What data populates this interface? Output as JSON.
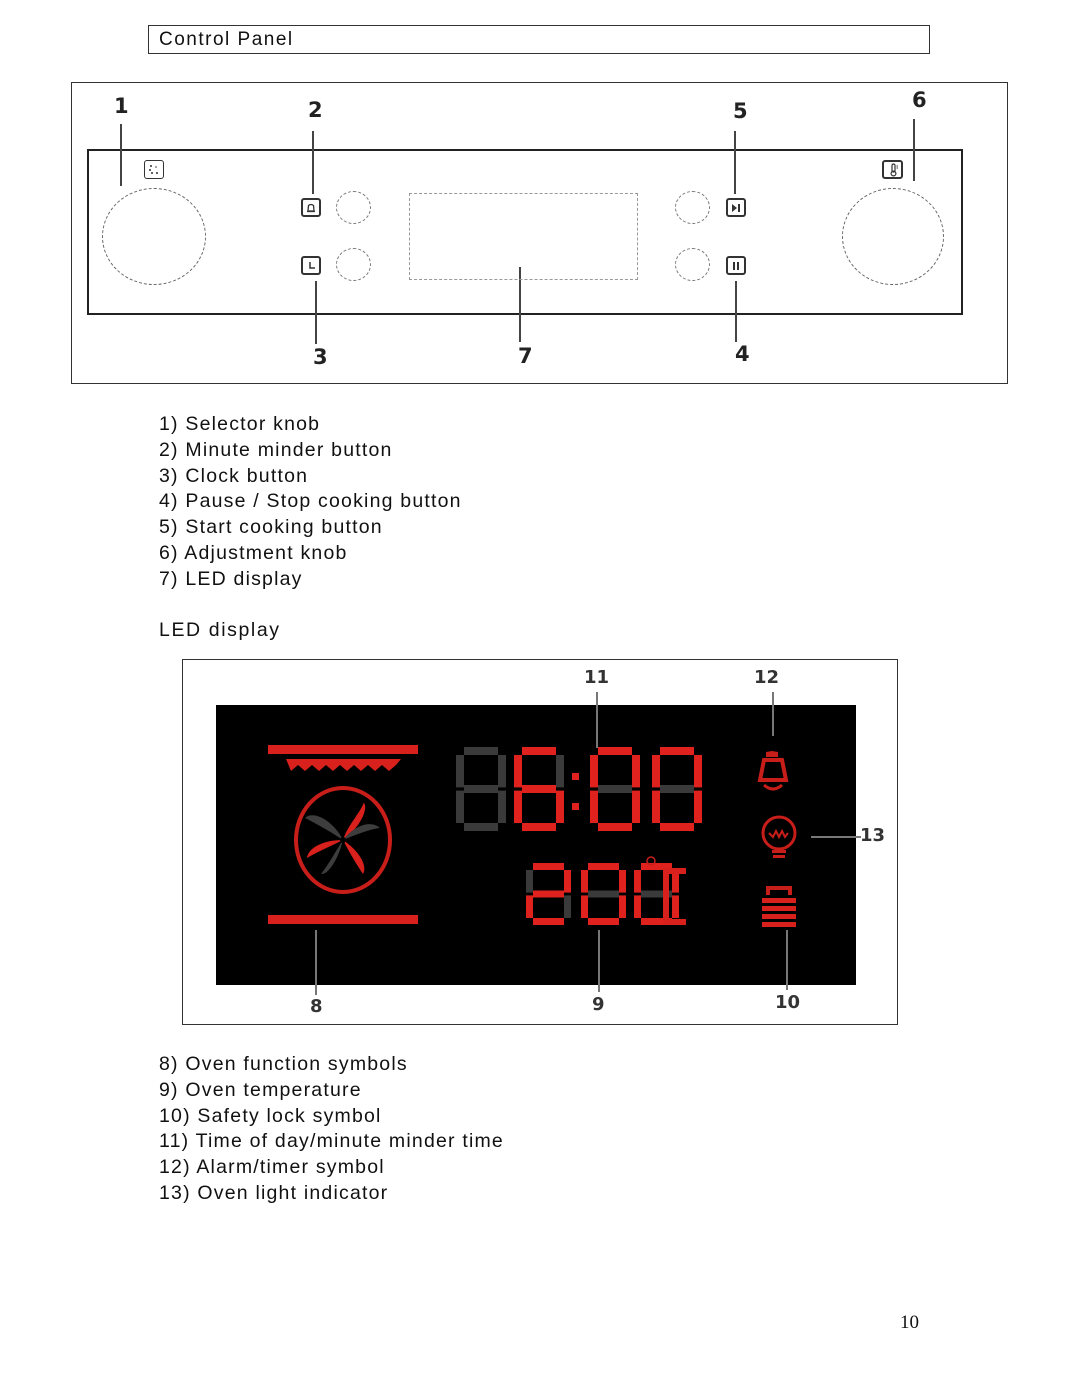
{
  "section_title": "Control Panel",
  "control_panel": {
    "callouts": [
      "1",
      "2",
      "3",
      "4",
      "5",
      "6",
      "7"
    ],
    "icons": {
      "selector": "oven-function-icon",
      "minute_minder": "bell-icon",
      "clock": "clock-icon",
      "start": "play-pause-icon",
      "pause": "pause-icon",
      "adjust": "thermometer-icon"
    }
  },
  "control_panel_legend": [
    {
      "num": "1)",
      "label": "Selector knob"
    },
    {
      "num": "2)",
      "label": "Minute minder button"
    },
    {
      "num": "3)",
      "label": "Clock button"
    },
    {
      "num": "4)",
      "label": "Pause / Stop cooking button"
    },
    {
      "num": "5)",
      "label": "Start cooking button"
    },
    {
      "num": "6)",
      "label": "Adjustment knob"
    },
    {
      "num": "7)",
      "label": "LED display"
    }
  ],
  "led_section_title": "LED display",
  "led_display": {
    "time": "06:00",
    "time_digits": [
      "0",
      "6",
      "0",
      "0"
    ],
    "time_dim_digits": [
      0
    ],
    "temperature": "200",
    "temperature_unit": "°C",
    "callouts": [
      "8",
      "9",
      "10",
      "11",
      "12",
      "13"
    ],
    "colors": {
      "active": "#e0221e",
      "inactive": "#3a3a3a",
      "background": "#000000"
    }
  },
  "led_legend": [
    {
      "num": "8)",
      "label": "Oven function symbols"
    },
    {
      "num": "9)",
      "label": "Oven temperature"
    },
    {
      "num": "10)",
      "label": "Safety lock symbol"
    },
    {
      "num": "11)",
      "label": "Time of day/minute minder time"
    },
    {
      "num": "12)",
      "label": "Alarm/timer symbol"
    },
    {
      "num": "13)",
      "label": "Oven light indicator"
    }
  ],
  "page_number": "10"
}
